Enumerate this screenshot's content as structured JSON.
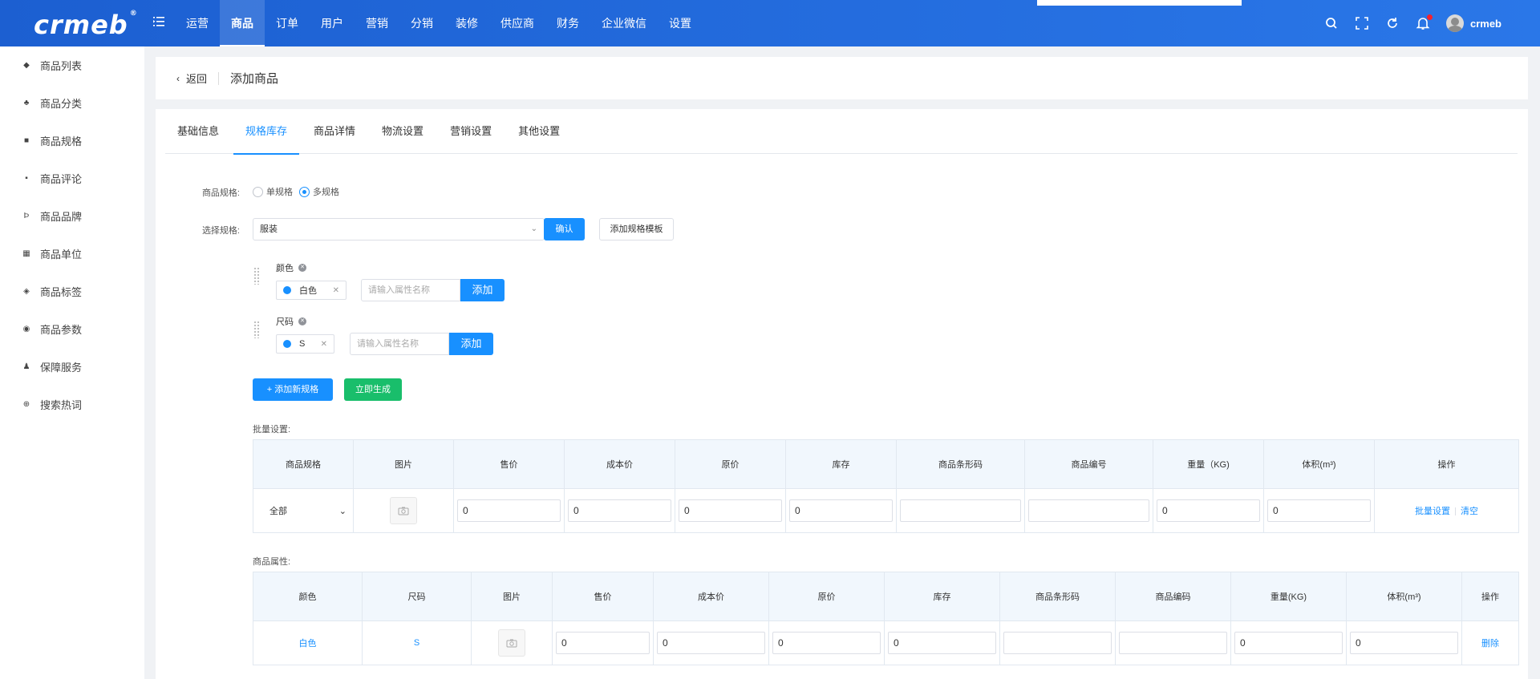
{
  "brand": {
    "logo_text": "crmeb",
    "logo_mark": "®"
  },
  "topnav": [
    "运营",
    "商品",
    "订单",
    "用户",
    "营销",
    "分销",
    "装修",
    "供应商",
    "财务",
    "企业微信",
    "设置"
  ],
  "topnav_active_index": 1,
  "user": {
    "name": "crmeb"
  },
  "sidebar": [
    "商品列表",
    "商品分类",
    "商品规格",
    "商品评论",
    "商品品牌",
    "商品单位",
    "商品标签",
    "商品参数",
    "保障服务",
    "搜索热词"
  ],
  "page": {
    "back_label": "返回",
    "title": "添加商品"
  },
  "tabs": [
    "基础信息",
    "规格库存",
    "商品详情",
    "物流设置",
    "营销设置",
    "其他设置"
  ],
  "tabs_active_index": 1,
  "spec": {
    "label": "商品规格:",
    "options": [
      "单规格",
      "多规格"
    ],
    "selected": "多规格"
  },
  "select_spec": {
    "label": "选择规格:",
    "value": "服装",
    "confirm_label": "确认",
    "add_template_label": "添加规格模板"
  },
  "attributes": [
    {
      "name": "颜色",
      "values": [
        "白色"
      ],
      "input_placeholder": "请输入属性名称",
      "add_label": "添加"
    },
    {
      "name": "尺码",
      "values": [
        "S"
      ],
      "input_placeholder": "请输入属性名称",
      "add_label": "添加"
    }
  ],
  "actions": {
    "add_spec_label": "添加新规格",
    "generate_label": "立即生成"
  },
  "batch": {
    "label": "批量设置:",
    "columns": [
      "商品规格",
      "图片",
      "售价",
      "成本价",
      "原价",
      "库存",
      "商品条形码",
      "商品编号",
      "重量（KG)",
      "体积(m³)",
      "操作"
    ],
    "row": {
      "spec": "全部",
      "price": "0",
      "cost": "0",
      "original": "0",
      "stock": "0",
      "barcode": "",
      "code": "",
      "weight": "0",
      "volume": "0"
    },
    "op_set": "批量设置",
    "op_clear": "清空"
  },
  "attrs_table": {
    "label": "商品属性:",
    "columns": [
      "颜色",
      "尺码",
      "图片",
      "售价",
      "成本价",
      "原价",
      "库存",
      "商品条形码",
      "商品编码",
      "重量(KG)",
      "体积(m³)",
      "操作"
    ],
    "row": {
      "color": "白色",
      "size": "S",
      "price": "0",
      "cost": "0",
      "original": "0",
      "stock": "0",
      "barcode": "",
      "code": "",
      "weight": "0",
      "volume": "0"
    },
    "op_delete": "删除"
  },
  "colors": {
    "primary": "#1890ff",
    "success": "#19be6b",
    "header": "#2a77e8"
  }
}
